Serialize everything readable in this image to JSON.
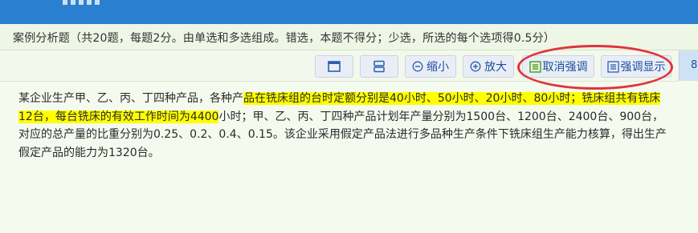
{
  "instruction": "案例分析题（共20题，每题2分。由单选和多选组成。错选，本题不得分；少选，所选的每个选项得0.5分）",
  "toolbar": {
    "layout_single_icon": "window-icon",
    "layout_split_icon": "split-horizontal-icon",
    "zoom_out_icon": "minus-circle-icon",
    "zoom_out_label": "缩小",
    "zoom_in_icon": "plus-circle-icon",
    "zoom_in_label": "放大",
    "cancel_highlight_icon": "list-highlight-icon",
    "cancel_highlight_label": "取消强调",
    "show_highlight_icon": "list-icon",
    "show_highlight_label": "强调显示"
  },
  "question_number_partial": "8",
  "passage": {
    "part1": "某企业生产甲、乙、丙、丁四种产品，各种产",
    "highlight": "品在铣床组的台时定额分别是40小时、50小时、20小时、80小时；铣床组共有铣床12台，每台铣床的有效工作时间为4400",
    "part2": "小时；甲、乙、丙、丁四种产品计划年产量分别为1500台、1200台、2400台、900台，对应的总产量的比重分别为0.25、0.2、0.4、0.15。该企业采用假定产品法进行多品种生产条件下铣床组生产能力核算，得出生产假定产品的能力为1320台。"
  },
  "colors": {
    "header_blue": "#2b7fd0",
    "highlight_yellow": "#ffff00",
    "annotation_red": "#e0343a",
    "button_text": "#1c4d9c"
  }
}
